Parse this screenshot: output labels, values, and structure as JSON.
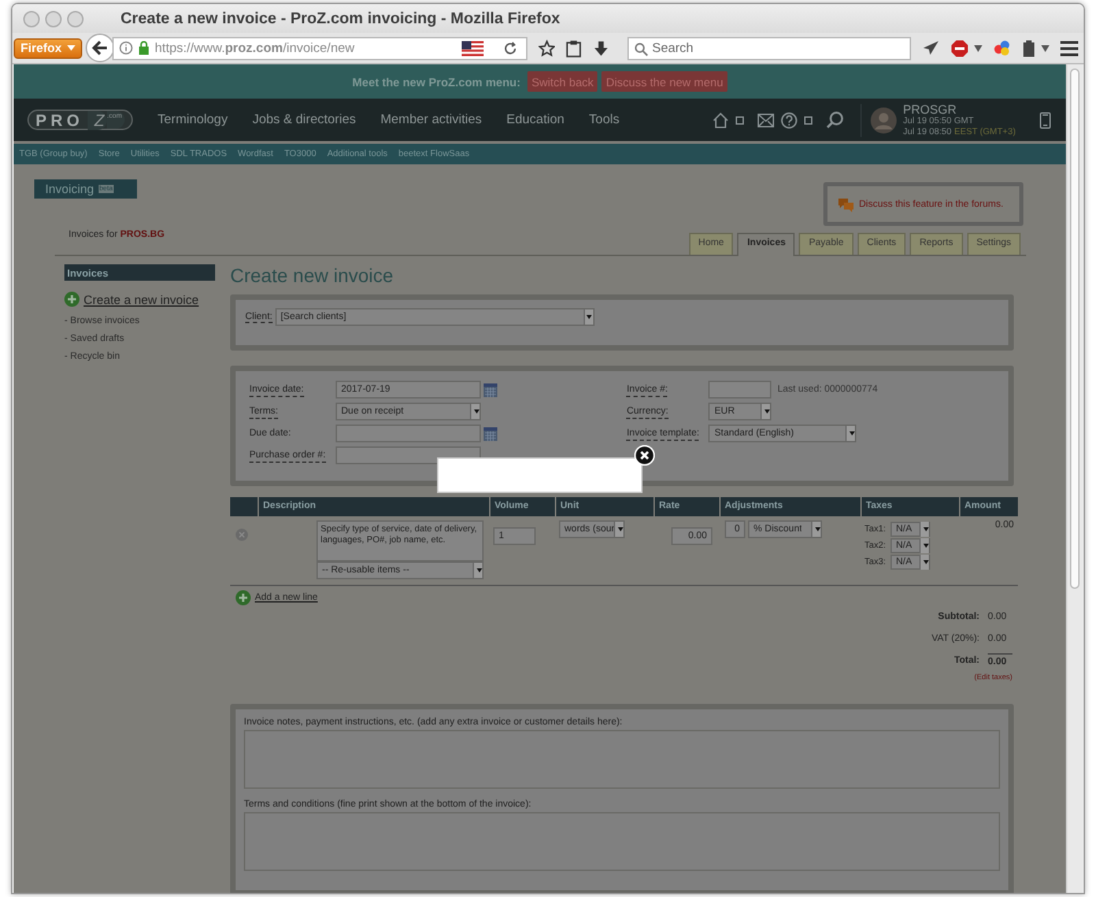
{
  "window": {
    "title": "Create a new invoice - ProZ.com invoicing - Mozilla Firefox"
  },
  "browser": {
    "menu_button": "Firefox",
    "url": "https://www.**proz.com**/invoice/new",
    "search": {
      "placeholder": "Search"
    }
  },
  "banner": {
    "text": "Meet the new ProZ.com menu:",
    "buttons": [
      "Switch back",
      "Discuss the new menu"
    ]
  },
  "nav": {
    "logo": {
      "main": "PRO",
      "mark": "Z",
      "suffix": ".com"
    },
    "items": [
      "Terminology",
      "Jobs & directories",
      "Member activities",
      "Education",
      "Tools"
    ],
    "user": {
      "name": "PROSGR",
      "gmt_time": "Jul 19 05:50 GMT",
      "local_time": "Jul 19 08:50",
      "timezone": "EEST (GMT+3)"
    }
  },
  "subnav": [
    "TGB (Group buy)",
    "Store",
    "Utilities",
    "SDL TRADOS",
    "Wordfast",
    "TO3000",
    "Additional tools",
    "beetext FlowSaas"
  ],
  "app_tab": {
    "title": "Invoicing",
    "badge": "beta"
  },
  "forum_link": "Discuss this feature in the forums.",
  "invoices_for": {
    "label": "Invoices for",
    "account": "PROS.BG"
  },
  "tabs": [
    {
      "label": "Home",
      "selected": false
    },
    {
      "label": "Invoices",
      "selected": true
    },
    {
      "label": "Payable",
      "selected": false
    },
    {
      "label": "Clients",
      "selected": false
    },
    {
      "label": "Reports",
      "selected": false
    },
    {
      "label": "Settings",
      "selected": false
    }
  ],
  "sidebar": {
    "heading": "Invoices",
    "create": "Create a new invoice",
    "links": [
      "- Browse invoices",
      "- Saved drafts",
      "- Recycle bin"
    ]
  },
  "heading": "Create new invoice",
  "client": {
    "label": "Client:",
    "value": "[Search clients]"
  },
  "details": {
    "left": [
      {
        "label": "Invoice date:",
        "kind": "date",
        "value": "2017-07-19"
      },
      {
        "label": "Terms:",
        "kind": "select",
        "value": "Due on receipt"
      },
      {
        "label": "Due date:",
        "kind": "date"
      },
      {
        "label": "Purchase order #:",
        "kind": "text"
      }
    ],
    "right": [
      {
        "label": "Invoice #:",
        "kind": "text",
        "note": "Last used: 0000000774"
      },
      {
        "label": "Currency:",
        "kind": "select",
        "value": "EUR"
      },
      {
        "label": "Invoice template:",
        "kind": "select",
        "value": "Standard (English)"
      }
    ]
  },
  "line_items": {
    "columns": [
      "Description",
      "Volume",
      "Unit",
      "Rate",
      "Adjustments",
      "Taxes",
      "Amount"
    ],
    "rows": [
      {
        "description": {
          "placeholder": "Specify type of service, date of delivery, languages, PO#, job name, etc."
        },
        "reusable": "-- Re-usable items --",
        "volume": "1",
        "unit": "words (sour",
        "rate": "0.00",
        "adjustment": "0",
        "adjustment_type": "% Discount",
        "taxes": [
          {
            "label": "Tax1:",
            "value": "N/A"
          },
          {
            "label": "Tax2:",
            "value": "N/A"
          },
          {
            "label": "Tax3:",
            "value": "N/A"
          }
        ],
        "amount": "0.00"
      }
    ],
    "add_line": "Add a new line"
  },
  "totals": [
    {
      "kind": "subtotal",
      "label": "Subtotal:",
      "value": "0.00"
    },
    {
      "kind": "tax",
      "label": "VAT (20%):",
      "value": "0.00"
    },
    {
      "kind": "total",
      "label": "Total:",
      "value": "0.00"
    }
  ],
  "edit_taxes": "(Edit taxes)",
  "notes": [
    {
      "label": "Invoice notes, payment instructions, etc. (add any extra invoice or customer details here):"
    },
    {
      "label": "Terms and conditions (fine print shown at the bottom of the invoice):"
    }
  ]
}
